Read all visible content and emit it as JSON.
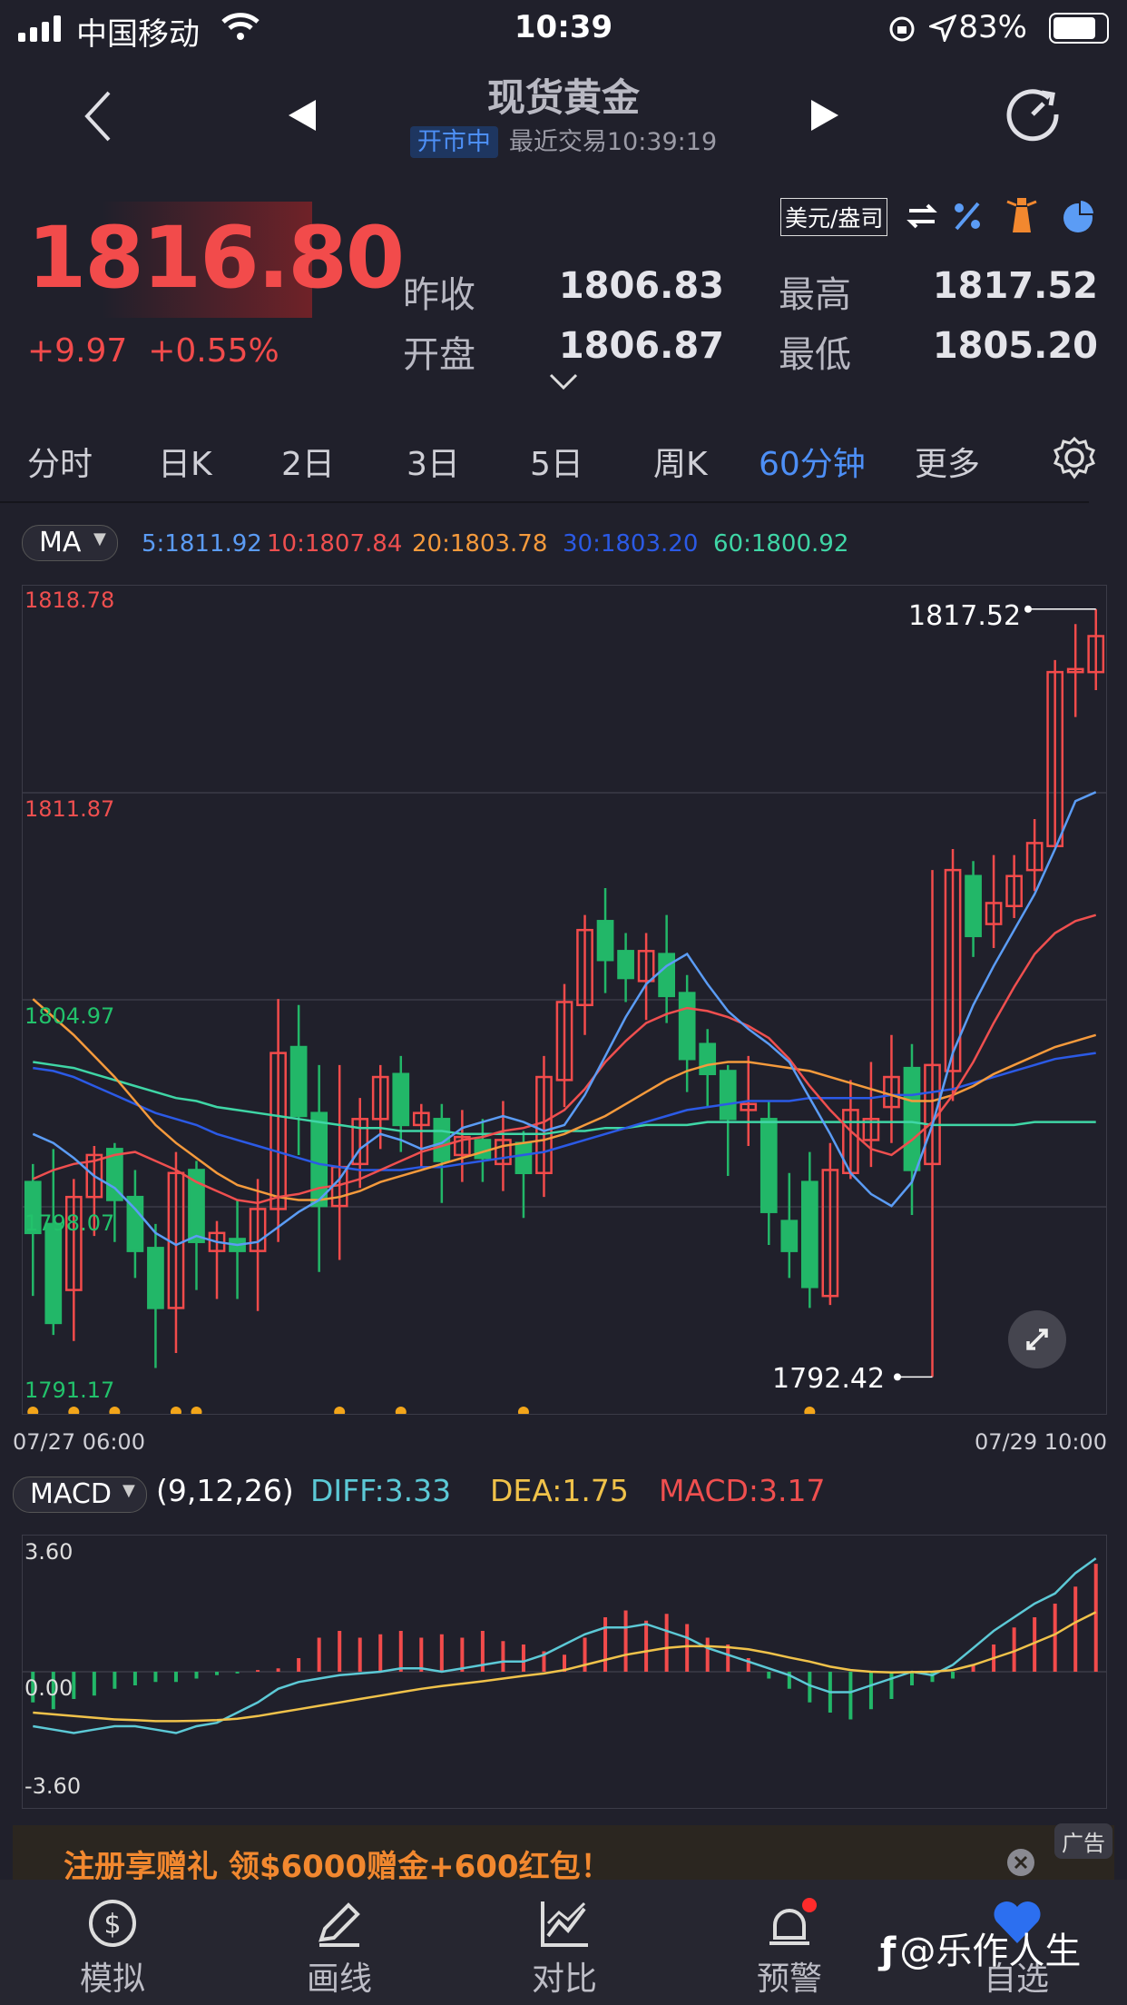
{
  "status": {
    "carrier": "中国移动",
    "time": "10:39",
    "battery": "83%"
  },
  "header": {
    "title": "现货黄金",
    "badge": "开市中",
    "last_trade": "最近交易10:39:19"
  },
  "quote": {
    "price": "1816.80",
    "change": "+9.97",
    "change_pct": "+0.55%",
    "unit": "美元/盎司",
    "prev_close_label": "昨收",
    "prev_close": "1806.83",
    "open_label": "开盘",
    "open": "1806.87",
    "high_label": "最高",
    "high": "1817.52",
    "low_label": "最低",
    "low": "1805.20"
  },
  "tabs": [
    "分时",
    "日K",
    "2日",
    "3日",
    "5日",
    "周K",
    "60分钟",
    "更多"
  ],
  "active_tab": 6,
  "ma": {
    "label": "MA",
    "v5": "5:1811.92",
    "v10": "10:1807.84",
    "v20": "20:1803.78",
    "v30": "30:1803.20",
    "v60": "60:1800.92"
  },
  "price_axis": {
    "top": "1818.78",
    "l2": "1811.87",
    "l3": "1804.97",
    "l4": "1798.07",
    "bottom": "1791.17"
  },
  "markers": {
    "max": "1817.52",
    "min": "1792.42"
  },
  "dates": {
    "start": "07/27 06:00",
    "end": "07/29 10:00"
  },
  "macd": {
    "label": "MACD",
    "params": "(9,12,26)",
    "diff": "DIFF:3.33",
    "dea": "DEA:1.75",
    "macd": "MACD:3.17",
    "top": "3.60",
    "zero": "0.00",
    "bottom": "-3.60"
  },
  "ad": {
    "text": "注册享赠礼 领$6000赠金+600红包！",
    "tag": "广告"
  },
  "bottom_nav": [
    "模拟",
    "画线",
    "对比",
    "预警",
    "自选"
  ],
  "watermark": "@乐作人生",
  "colors": {
    "up": "#f24b4b",
    "down": "#22b768",
    "accent": "#4d8ff6",
    "ma5": "#5b9cf5",
    "ma10": "#ef4f4f",
    "ma20": "#f59a3c",
    "ma30": "#2b5ae6",
    "ma60": "#3fd6a6",
    "diff": "#5cc9d6",
    "dea": "#f0c24a"
  },
  "chart_data": {
    "type": "candlestick",
    "ylim": [
      1791.17,
      1818.78
    ],
    "candles": [
      [
        1798.9,
        1797.2,
        1799.5,
        1795.1
      ],
      [
        1797.5,
        1794.2,
        1800.0,
        1793.8
      ],
      [
        1795.3,
        1798.4,
        1799.0,
        1793.6
      ],
      [
        1798.4,
        1799.8,
        1800.1,
        1797.1
      ],
      [
        1800.0,
        1798.3,
        1800.2,
        1796.9
      ],
      [
        1798.4,
        1796.6,
        1799.3,
        1795.7
      ],
      [
        1796.7,
        1794.7,
        1797.5,
        1792.7
      ],
      [
        1794.7,
        1799.2,
        1799.9,
        1793.2
      ],
      [
        1799.3,
        1796.9,
        1799.6,
        1795.3
      ],
      [
        1796.6,
        1797.2,
        1797.6,
        1795.0
      ],
      [
        1797.0,
        1796.6,
        1798.3,
        1795.0
      ],
      [
        1796.6,
        1798.0,
        1799.0,
        1794.6
      ],
      [
        1798.0,
        1803.2,
        1805.0,
        1796.9
      ],
      [
        1803.4,
        1801.1,
        1804.8,
        1799.8
      ],
      [
        1801.2,
        1798.1,
        1802.8,
        1795.9
      ],
      [
        1798.1,
        1799.4,
        1802.8,
        1796.3
      ],
      [
        1799.5,
        1801.0,
        1801.7,
        1798.7
      ],
      [
        1801.0,
        1802.4,
        1802.8,
        1800.0
      ],
      [
        1802.5,
        1800.8,
        1803.1,
        1799.9
      ],
      [
        1800.8,
        1801.2,
        1801.5,
        1799.4
      ],
      [
        1801.0,
        1799.6,
        1801.5,
        1798.2
      ],
      [
        1799.8,
        1800.4,
        1801.3,
        1798.9
      ],
      [
        1800.3,
        1799.7,
        1801.0,
        1798.9
      ],
      [
        1799.5,
        1800.3,
        1801.6,
        1798.6
      ],
      [
        1800.2,
        1799.2,
        1800.6,
        1797.7
      ],
      [
        1799.2,
        1802.4,
        1803.1,
        1798.4
      ],
      [
        1802.3,
        1804.9,
        1805.5,
        1801.4
      ],
      [
        1804.8,
        1807.3,
        1807.8,
        1803.8
      ],
      [
        1807.6,
        1806.3,
        1808.7,
        1805.2
      ],
      [
        1806.6,
        1805.7,
        1807.2,
        1804.9
      ],
      [
        1805.6,
        1806.6,
        1807.2,
        1804.3
      ],
      [
        1806.5,
        1805.1,
        1807.8,
        1804.2
      ],
      [
        1805.2,
        1803.0,
        1805.8,
        1801.9
      ],
      [
        1803.5,
        1802.5,
        1804.0,
        1801.4
      ],
      [
        1802.6,
        1801.0,
        1802.8,
        1799.1
      ],
      [
        1801.3,
        1801.5,
        1803.1,
        1800.1
      ],
      [
        1801.0,
        1797.9,
        1801.6,
        1796.8
      ],
      [
        1797.6,
        1796.6,
        1799.2,
        1795.7
      ],
      [
        1798.9,
        1795.4,
        1799.9,
        1794.7
      ],
      [
        1795.1,
        1799.3,
        1800.2,
        1794.8
      ],
      [
        1799.2,
        1801.3,
        1802.3,
        1799.0
      ],
      [
        1800.3,
        1801.0,
        1802.9,
        1799.4
      ],
      [
        1801.4,
        1802.4,
        1803.8,
        1800.2
      ],
      [
        1802.7,
        1799.3,
        1803.5,
        1797.8
      ],
      [
        1799.5,
        1802.8,
        1809.3,
        1792.4
      ],
      [
        1802.6,
        1809.3,
        1810.0,
        1801.6
      ],
      [
        1809.1,
        1807.1,
        1809.6,
        1806.4
      ],
      [
        1807.5,
        1808.2,
        1809.8,
        1806.7
      ],
      [
        1808.1,
        1809.1,
        1809.8,
        1807.7
      ],
      [
        1809.3,
        1810.2,
        1811.0,
        1808.6
      ],
      [
        1810.1,
        1815.9,
        1816.3,
        1810.1
      ],
      [
        1815.9,
        1816.0,
        1817.5,
        1814.4
      ],
      [
        1815.9,
        1817.1,
        1818.0,
        1815.3
      ]
    ],
    "ma5": [
      1800.5,
      1800.2,
      1799.7,
      1799.1,
      1798.7,
      1798.0,
      1797.2,
      1796.8,
      1797.1,
      1796.9,
      1796.8,
      1796.9,
      1797.4,
      1797.9,
      1798.3,
      1799.0,
      1800.0,
      1800.5,
      1800.3,
      1800.0,
      1800.2,
      1800.7,
      1800.9,
      1801.1,
      1800.9,
      1800.6,
      1800.8,
      1801.8,
      1803.1,
      1804.4,
      1805.5,
      1806.1,
      1806.5,
      1805.5,
      1804.6,
      1804.0,
      1803.5,
      1802.9,
      1801.7,
      1800.5,
      1799.2,
      1798.5,
      1798.1,
      1798.9,
      1800.8,
      1803.2,
      1804.8,
      1806.1,
      1807.3,
      1808.5,
      1810.0,
      1811.6,
      1811.9
    ],
    "ma10": [
      1799.0,
      1799.3,
      1799.5,
      1799.6,
      1799.8,
      1799.9,
      1799.6,
      1799.3,
      1798.9,
      1798.6,
      1798.3,
      1798.2,
      1798.4,
      1798.5,
      1798.7,
      1798.8,
      1799.0,
      1799.3,
      1799.6,
      1799.9,
      1800.1,
      1800.3,
      1800.4,
      1800.6,
      1800.7,
      1800.9,
      1801.3,
      1802.0,
      1802.9,
      1803.6,
      1804.2,
      1804.5,
      1804.7,
      1804.6,
      1804.4,
      1804.1,
      1803.7,
      1803.0,
      1802.1,
      1801.3,
      1800.6,
      1800.0,
      1799.8,
      1800.3,
      1800.9,
      1801.8,
      1802.9,
      1804.2,
      1805.4,
      1806.5,
      1807.2,
      1807.6,
      1807.8
    ],
    "ma20": [
      1805.0,
      1804.4,
      1803.8,
      1803.1,
      1802.4,
      1801.6,
      1800.8,
      1800.2,
      1799.7,
      1799.2,
      1798.8,
      1798.6,
      1798.4,
      1798.3,
      1798.3,
      1798.4,
      1798.6,
      1798.9,
      1799.1,
      1799.3,
      1799.5,
      1799.7,
      1799.9,
      1800.1,
      1800.2,
      1800.3,
      1800.5,
      1800.8,
      1801.1,
      1801.5,
      1801.9,
      1802.3,
      1802.6,
      1802.8,
      1802.9,
      1802.9,
      1802.8,
      1802.7,
      1802.6,
      1802.4,
      1802.2,
      1802.0,
      1801.8,
      1801.6,
      1801.6,
      1801.8,
      1802.1,
      1802.5,
      1802.8,
      1803.1,
      1803.4,
      1803.6,
      1803.8
    ],
    "ma30": [
      1802.7,
      1802.6,
      1802.4,
      1802.1,
      1801.8,
      1801.5,
      1801.2,
      1801.0,
      1800.8,
      1800.5,
      1800.3,
      1800.1,
      1799.9,
      1799.7,
      1799.5,
      1799.4,
      1799.3,
      1799.3,
      1799.3,
      1799.4,
      1799.4,
      1799.5,
      1799.6,
      1799.7,
      1799.8,
      1799.9,
      1800.1,
      1800.3,
      1800.5,
      1800.7,
      1800.9,
      1801.1,
      1801.3,
      1801.4,
      1801.5,
      1801.6,
      1801.6,
      1801.6,
      1801.7,
      1801.7,
      1801.7,
      1801.7,
      1801.8,
      1801.8,
      1801.9,
      1802.0,
      1802.2,
      1802.4,
      1802.6,
      1802.8,
      1803.0,
      1803.1,
      1803.2
    ],
    "ma60": [
      1802.9,
      1802.8,
      1802.7,
      1802.5,
      1802.3,
      1802.1,
      1801.9,
      1801.7,
      1801.6,
      1801.4,
      1801.3,
      1801.2,
      1801.1,
      1801.0,
      1800.9,
      1800.8,
      1800.7,
      1800.7,
      1800.6,
      1800.6,
      1800.6,
      1800.5,
      1800.5,
      1800.5,
      1800.5,
      1800.5,
      1800.6,
      1800.6,
      1800.7,
      1800.7,
      1800.8,
      1800.8,
      1800.8,
      1800.9,
      1800.9,
      1800.9,
      1800.9,
      1800.9,
      1800.9,
      1800.9,
      1800.9,
      1800.9,
      1800.9,
      1800.9,
      1800.8,
      1800.8,
      1800.8,
      1800.8,
      1800.8,
      1800.9,
      1800.9,
      1800.9,
      1800.9
    ],
    "macd_ylim": [
      -3.6,
      3.6
    ],
    "macd_hist": [
      -0.9,
      -1.1,
      -0.8,
      -0.7,
      -0.5,
      -0.4,
      -0.3,
      -0.3,
      -0.2,
      -0.1,
      -0.05,
      0.05,
      0.1,
      0.4,
      1.0,
      1.2,
      1.0,
      1.1,
      1.2,
      1.0,
      1.1,
      1.0,
      1.2,
      0.9,
      0.8,
      0.6,
      0.5,
      1.0,
      1.6,
      1.8,
      1.5,
      1.7,
      1.4,
      1.0,
      0.8,
      0.4,
      -0.2,
      -0.5,
      -0.9,
      -1.2,
      -1.4,
      -1.1,
      -0.8,
      -0.4,
      -0.3,
      -0.2,
      0.2,
      0.8,
      1.3,
      1.6,
      2.0,
      2.5,
      3.17
    ],
    "diff": [
      -1.6,
      -1.7,
      -1.8,
      -1.7,
      -1.6,
      -1.6,
      -1.7,
      -1.8,
      -1.6,
      -1.5,
      -1.2,
      -0.9,
      -0.5,
      -0.3,
      -0.2,
      -0.1,
      -0.05,
      0.0,
      0.1,
      0.1,
      0.0,
      0.1,
      0.2,
      0.3,
      0.3,
      0.5,
      0.8,
      1.1,
      1.3,
      1.3,
      1.4,
      1.2,
      1.0,
      0.7,
      0.5,
      0.3,
      0.1,
      -0.1,
      -0.4,
      -0.6,
      -0.6,
      -0.4,
      -0.2,
      0.0,
      -0.1,
      0.2,
      0.7,
      1.2,
      1.6,
      2.0,
      2.3,
      2.9,
      3.33
    ],
    "dea": [
      -1.2,
      -1.25,
      -1.3,
      -1.35,
      -1.4,
      -1.42,
      -1.45,
      -1.45,
      -1.44,
      -1.42,
      -1.38,
      -1.3,
      -1.2,
      -1.1,
      -1.0,
      -0.9,
      -0.8,
      -0.7,
      -0.6,
      -0.5,
      -0.42,
      -0.35,
      -0.28,
      -0.2,
      -0.12,
      -0.05,
      0.05,
      0.2,
      0.35,
      0.5,
      0.6,
      0.7,
      0.75,
      0.75,
      0.72,
      0.66,
      0.55,
      0.42,
      0.3,
      0.15,
      0.05,
      0.0,
      -0.02,
      -0.01,
      0.0,
      0.05,
      0.2,
      0.4,
      0.6,
      0.85,
      1.1,
      1.45,
      1.75
    ],
    "signal_dots": [
      0,
      2,
      4,
      7,
      8,
      15,
      18,
      24,
      38
    ]
  }
}
